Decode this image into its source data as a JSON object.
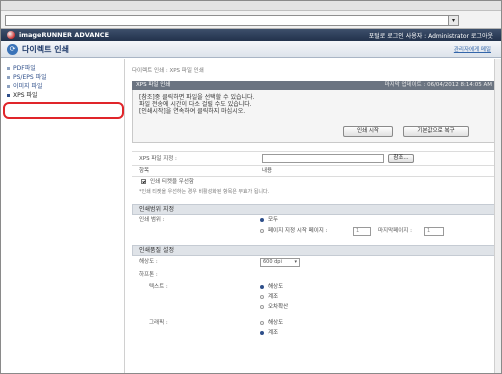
{
  "browser": {
    "dropdown_glyph": "▾"
  },
  "brandbar": {
    "brand": "imageRUNNER ADVANCE",
    "user": "포털로  로그인 사용자 : Administrator 로그아웃"
  },
  "titlebar": {
    "title": "다이렉트 인쇄",
    "admin_link": "관리자에게 메일"
  },
  "sidebar": {
    "items": [
      {
        "label": "PDF파일"
      },
      {
        "label": "PS/EPS 파일"
      },
      {
        "label": "이미지 파일"
      },
      {
        "label": "XPS 파일"
      }
    ]
  },
  "main": {
    "breadcrumb": "다이렉트 인쇄 : XPS 파일 인쇄",
    "panel_title": "XPS 파일 인쇄",
    "last_update": "마지막 업데이트 : 06/04/2012 8:14:05 AM",
    "message_lines": [
      "[참조]중 클릭하면 파일을 선택할 수 있습니다.",
      "파일 전송에 시간이 다소 걸릴 수도 있습니다.",
      "[인쇄시작]을 연속하여 클릭하지 마십시오."
    ],
    "print_start_button": "인쇄 시작",
    "reset_button": "기본값으로 복구",
    "file_label": "XPS 파일 지정 :",
    "browse_button": "참조...",
    "col_item": "항목",
    "col_content": "내용",
    "ticket_label": "인쇄 티켓을 우선함",
    "ticket_note": "*인쇄 티켓을 우선하는 경우 비활성화된 항목은 무효가 됩니다.",
    "range_section": "인쇄범위 지정",
    "range_label": "인쇄 범위 :",
    "range_all": "모두",
    "range_pages": "페이지 지정 시작 페이지 :",
    "range_end": "마지막페이지 :",
    "range_start_value": "1",
    "range_end_value": "1",
    "quality_section": "인쇄품질 설정",
    "resolution_label": "해상도 :",
    "resolution_value": "600 dpi",
    "halftone_label": "하프톤 :",
    "text_label": "텍스트 :",
    "text_opt1": "해상도",
    "text_opt2": "계조",
    "text_opt3": "오차확산",
    "graphics_label": "그래픽 :",
    "graphics_opt1": "해상도",
    "graphics_opt2": "계조"
  }
}
